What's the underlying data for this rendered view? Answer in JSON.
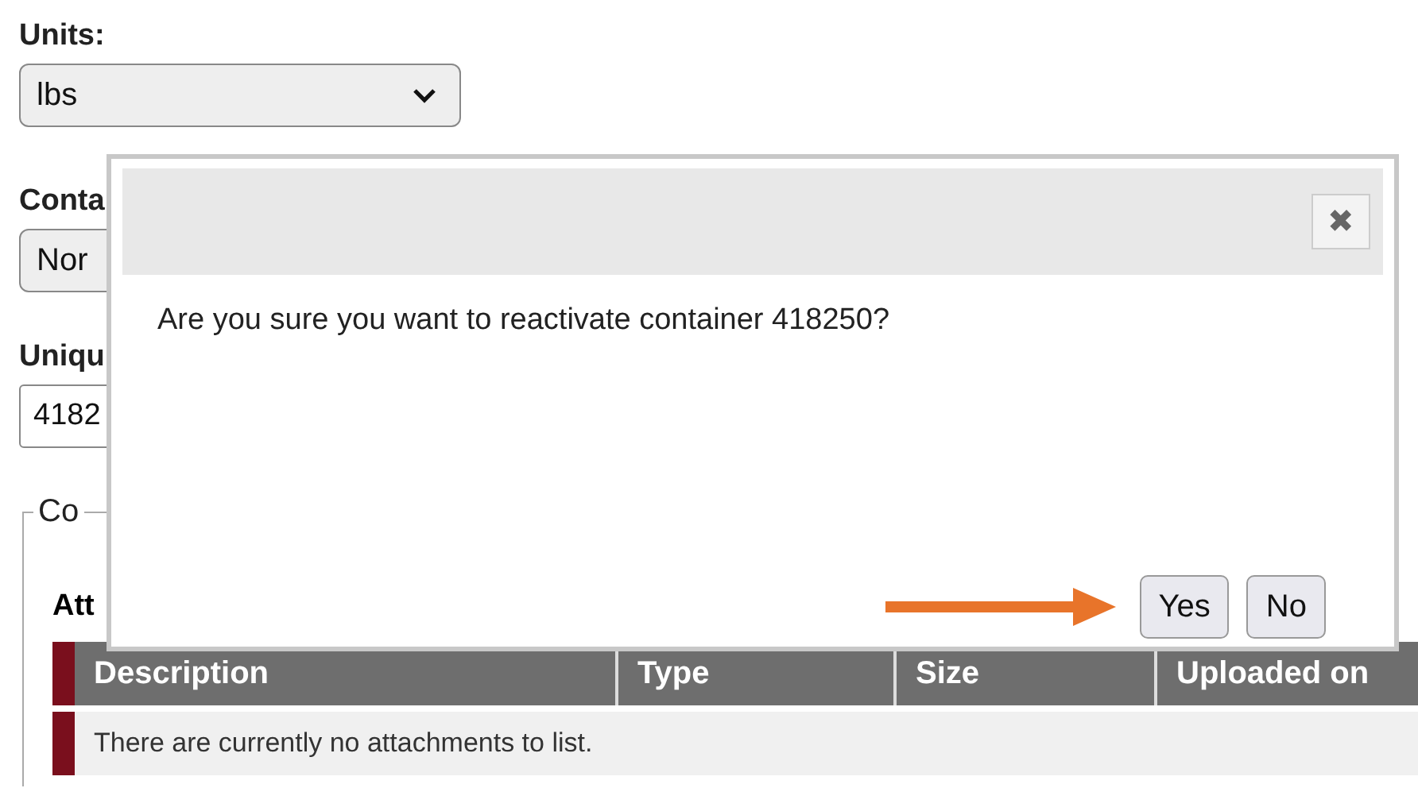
{
  "form": {
    "units_label": "Units:",
    "units_select": {
      "value": "lbs"
    },
    "container_label": "Conta",
    "container_select": {
      "value": "Nor"
    },
    "unique_label": "Uniqu",
    "unique_input": {
      "value": "4182"
    },
    "fieldset_legend": "Co",
    "attachments_heading": "Att",
    "attachments_table": {
      "columns": [
        "Description",
        "Type",
        "Size",
        "Uploaded on"
      ],
      "empty_message": "There are currently no attachments to list."
    }
  },
  "dialog": {
    "message": "Are you sure you want to reactivate container 418250?",
    "close_label": "✖",
    "buttons": [
      {
        "label": "Yes",
        "highlighted": true
      },
      {
        "label": "No",
        "highlighted": false
      }
    ]
  }
}
